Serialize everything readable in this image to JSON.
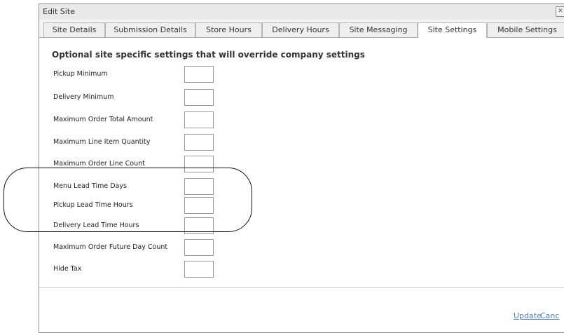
{
  "dialog": {
    "title": "Edit Site",
    "close_glyph": "✕"
  },
  "tabs": [
    {
      "label": "Site Details",
      "active": false
    },
    {
      "label": "Submission Details",
      "active": false
    },
    {
      "label": "Store Hours",
      "active": false
    },
    {
      "label": "Delivery Hours",
      "active": false
    },
    {
      "label": "Site Messaging",
      "active": false
    },
    {
      "label": "Site Settings",
      "active": true
    },
    {
      "label": "Mobile Settings",
      "active": false
    }
  ],
  "section": {
    "heading": "Optional site specific settings that will override company settings"
  },
  "fields": [
    {
      "label": "Pickup Minimum",
      "value": ""
    },
    {
      "label": "Delivery Minimum",
      "value": ""
    },
    {
      "label": "Maximum Order Total Amount",
      "value": ""
    },
    {
      "label": "Maximum Line Item Quantity",
      "value": ""
    },
    {
      "label": "Maximum Order Line Count",
      "value": ""
    },
    {
      "label": "Menu Lead Time Days",
      "value": ""
    },
    {
      "label": "Pickup Lead Time Hours",
      "value": ""
    },
    {
      "label": "Delivery Lead Time Hours",
      "value": ""
    },
    {
      "label": "Maximum Order Future Day Count",
      "value": ""
    },
    {
      "label": "Hide Tax",
      "value": ""
    }
  ],
  "actions": {
    "update": "Update",
    "cancel": "Canc"
  }
}
